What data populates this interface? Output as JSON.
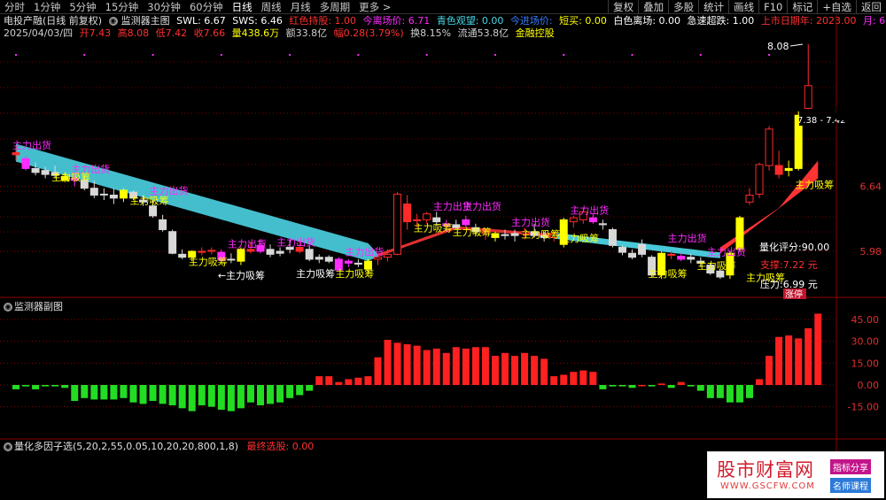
{
  "toolbar": {
    "periods": [
      "分时",
      "1分钟",
      "5分钟",
      "15分钟",
      "30分钟",
      "60分钟",
      "日线",
      "周线",
      "月线",
      "多周期",
      "更多 >"
    ],
    "active_period": "日线",
    "buttons": [
      "复权",
      "叠加",
      "多股",
      "统计",
      "画线",
      "F10",
      "标记",
      "+自选",
      "返回"
    ]
  },
  "header": {
    "stock": "电投产融(日线 前复权)",
    "indicator": "监测器主图",
    "swl": "SWL: 6.67",
    "sws": "SWS: 6.46",
    "hongse": "红色持股: 1.00",
    "jinri": "今离场价: 6.71",
    "qingse": "青色观望: 0.00",
    "jinjin": "今进场价: ",
    "duanmai": "短买: 0.00",
    "baise": "白色离场: 0.00",
    "jisu": "急速超跌: 1.00",
    "shangshi": "上市日期年: 2023.00",
    "yue": "月: 6.00"
  },
  "quote": {
    "date": "2025/04/03/四",
    "open": "开7.43",
    "high": "高8.08",
    "low": "低7.42",
    "close": "收7.66",
    "volume": "量438.6万",
    "amount": "额33.8亿",
    "change": "幅0.28(3.79%)",
    "turnover": "换8.15%",
    "float": "流通53.8亿",
    "concept": "金融控股"
  },
  "main_chart": {
    "price_ticks": [
      "7.38",
      "6.64",
      "5.98"
    ],
    "high_label": "8.08",
    "current_range": "7.38 - 7.42",
    "annotations": {
      "chu": "主力出货",
      "xi": "主力吸筹",
      "xi2": "主力吸筹",
      "xi_arrow": "←主力吸筹"
    },
    "score": "量化评分:90.00",
    "support": "支撑:7.22 元",
    "pressure": "压力:6.99 元",
    "zhangting": "涨停"
  },
  "sub_chart": {
    "title": "监测器副图",
    "ticks": [
      "45.00",
      "30.00",
      "15.00",
      "0.00",
      "-15.00"
    ]
  },
  "factor_panel": {
    "title": "量化多因子选(5,20,2,55,0.05,10,20,20,800,1,8)",
    "result": "最终选股: 0.00"
  },
  "watermark": {
    "name": "股市财富网",
    "url": "WWW.GSCFW.COM",
    "tag1": "指标分享",
    "tag2": "名师课程"
  },
  "colors": {
    "up": "#ff2a2a",
    "down": "#00d000",
    "magenta": "#ff2bff",
    "yellow": "#ffff00",
    "cyan": "#48c8d8",
    "grid": "#8b0000"
  },
  "chart_data": {
    "type": "candlestick",
    "candles": [
      {
        "o": 6.98,
        "h": 7.05,
        "l": 6.9,
        "c": 6.96,
        "cl": "red"
      },
      {
        "o": 6.92,
        "h": 6.95,
        "l": 6.8,
        "c": 6.82,
        "cl": "magenta"
      },
      {
        "o": 6.82,
        "h": 6.88,
        "l": 6.75,
        "c": 6.78,
        "cl": "white"
      },
      {
        "o": 6.8,
        "h": 6.84,
        "l": 6.72,
        "c": 6.76,
        "cl": "white"
      },
      {
        "o": 6.78,
        "h": 6.85,
        "l": 6.72,
        "c": 6.75,
        "cl": "white"
      },
      {
        "o": 6.74,
        "h": 6.78,
        "l": 6.68,
        "c": 6.7,
        "cl": "yellow"
      },
      {
        "o": 6.7,
        "h": 6.76,
        "l": 6.64,
        "c": 6.72,
        "cl": "magenta"
      },
      {
        "o": 6.7,
        "h": 6.74,
        "l": 6.6,
        "c": 6.62,
        "cl": "white"
      },
      {
        "o": 6.62,
        "h": 6.7,
        "l": 6.52,
        "c": 6.55,
        "cl": "white"
      },
      {
        "o": 6.56,
        "h": 6.62,
        "l": 6.5,
        "c": 6.56,
        "cl": "white"
      },
      {
        "o": 6.55,
        "h": 6.62,
        "l": 6.46,
        "c": 6.52,
        "cl": "white"
      },
      {
        "o": 6.52,
        "h": 6.62,
        "l": 6.48,
        "c": 6.6,
        "cl": "yellow"
      },
      {
        "o": 6.58,
        "h": 6.6,
        "l": 6.5,
        "c": 6.52,
        "cl": "white"
      },
      {
        "o": 6.5,
        "h": 6.55,
        "l": 6.44,
        "c": 6.48,
        "cl": "white"
      },
      {
        "o": 6.44,
        "h": 6.5,
        "l": 6.32,
        "c": 6.34,
        "cl": "white"
      },
      {
        "o": 6.3,
        "h": 6.35,
        "l": 6.18,
        "c": 6.2,
        "cl": "white"
      },
      {
        "o": 6.18,
        "h": 6.2,
        "l": 5.95,
        "c": 5.96,
        "cl": "white"
      },
      {
        "o": 5.95,
        "h": 6.0,
        "l": 5.9,
        "c": 5.92,
        "cl": "white"
      },
      {
        "o": 5.92,
        "h": 5.99,
        "l": 5.88,
        "c": 5.98,
        "cl": "yellow"
      },
      {
        "o": 5.98,
        "h": 6.02,
        "l": 5.94,
        "c": 5.97,
        "cl": "red"
      },
      {
        "o": 5.98,
        "h": 6.02,
        "l": 5.95,
        "c": 5.99,
        "cl": "red"
      },
      {
        "o": 5.97,
        "h": 6.0,
        "l": 5.88,
        "c": 5.89,
        "cl": "magenta"
      },
      {
        "o": 5.9,
        "h": 5.96,
        "l": 5.86,
        "c": 5.9,
        "cl": "white"
      },
      {
        "o": 5.88,
        "h": 6.02,
        "l": 5.84,
        "c": 6.0,
        "cl": "yellow"
      },
      {
        "o": 6.0,
        "h": 6.08,
        "l": 5.96,
        "c": 5.98,
        "cl": "red"
      },
      {
        "o": 5.98,
        "h": 6.1,
        "l": 5.96,
        "c": 6.04,
        "cl": "magenta"
      },
      {
        "o": 6.0,
        "h": 6.05,
        "l": 5.92,
        "c": 5.95,
        "cl": "white"
      },
      {
        "o": 5.96,
        "h": 6.02,
        "l": 5.93,
        "c": 5.98,
        "cl": "white"
      },
      {
        "o": 6.02,
        "h": 6.1,
        "l": 5.96,
        "c": 6.0,
        "cl": "white"
      },
      {
        "o": 6.02,
        "h": 6.08,
        "l": 5.96,
        "c": 5.98,
        "cl": "red"
      },
      {
        "o": 6.0,
        "h": 6.04,
        "l": 5.88,
        "c": 5.9,
        "cl": "white"
      },
      {
        "o": 5.9,
        "h": 5.95,
        "l": 5.86,
        "c": 5.92,
        "cl": "white"
      },
      {
        "o": 5.92,
        "h": 5.94,
        "l": 5.86,
        "c": 5.88,
        "cl": "white"
      },
      {
        "o": 5.9,
        "h": 5.92,
        "l": 5.78,
        "c": 5.79,
        "cl": "magenta"
      },
      {
        "o": 5.88,
        "h": 5.9,
        "l": 5.82,
        "c": 5.86,
        "cl": "magenta"
      },
      {
        "o": 5.86,
        "h": 5.9,
        "l": 5.82,
        "c": 5.85,
        "cl": "white"
      },
      {
        "o": 5.8,
        "h": 5.9,
        "l": 5.76,
        "c": 5.88,
        "cl": "yellow"
      },
      {
        "o": 5.9,
        "h": 5.96,
        "l": 5.84,
        "c": 5.92,
        "cl": "red"
      },
      {
        "o": 5.92,
        "h": 6.0,
        "l": 5.88,
        "c": 5.95,
        "cl": "red"
      },
      {
        "o": 5.95,
        "h": 6.58,
        "l": 5.94,
        "c": 6.56,
        "cl": "red"
      },
      {
        "o": 6.46,
        "h": 6.55,
        "l": 6.2,
        "c": 6.28,
        "cl": "red"
      },
      {
        "o": 6.3,
        "h": 6.36,
        "l": 6.22,
        "c": 6.3,
        "cl": "red"
      },
      {
        "o": 6.3,
        "h": 6.38,
        "l": 6.26,
        "c": 6.36,
        "cl": "red"
      },
      {
        "o": 6.32,
        "h": 6.38,
        "l": 6.24,
        "c": 6.28,
        "cl": "white"
      },
      {
        "o": 6.26,
        "h": 6.3,
        "l": 6.18,
        "c": 6.24,
        "cl": "magenta"
      },
      {
        "o": 6.25,
        "h": 6.3,
        "l": 6.2,
        "c": 6.22,
        "cl": "white"
      },
      {
        "o": 6.25,
        "h": 6.34,
        "l": 6.22,
        "c": 6.3,
        "cl": "magenta"
      },
      {
        "o": 6.22,
        "h": 6.26,
        "l": 6.14,
        "c": 6.18,
        "cl": "white"
      },
      {
        "o": 6.16,
        "h": 6.22,
        "l": 6.1,
        "c": 6.18,
        "cl": "red"
      },
      {
        "o": 6.12,
        "h": 6.18,
        "l": 6.08,
        "c": 6.16,
        "cl": "yellow"
      },
      {
        "o": 6.15,
        "h": 6.2,
        "l": 6.1,
        "c": 6.14,
        "cl": "white"
      },
      {
        "o": 6.14,
        "h": 6.2,
        "l": 6.08,
        "c": 6.16,
        "cl": "white"
      },
      {
        "o": 6.16,
        "h": 6.22,
        "l": 6.1,
        "c": 6.18,
        "cl": "red"
      },
      {
        "o": 6.18,
        "h": 6.26,
        "l": 6.12,
        "c": 6.14,
        "cl": "white"
      },
      {
        "o": 6.14,
        "h": 6.18,
        "l": 6.08,
        "c": 6.12,
        "cl": "white"
      },
      {
        "o": 6.12,
        "h": 6.18,
        "l": 6.08,
        "c": 6.16,
        "cl": "red"
      },
      {
        "o": 6.05,
        "h": 6.32,
        "l": 6.02,
        "c": 6.3,
        "cl": "yellow"
      },
      {
        "o": 6.28,
        "h": 6.34,
        "l": 6.22,
        "c": 6.32,
        "cl": "red"
      },
      {
        "o": 6.3,
        "h": 6.42,
        "l": 6.26,
        "c": 6.38,
        "cl": "red"
      },
      {
        "o": 6.32,
        "h": 6.36,
        "l": 6.26,
        "c": 6.28,
        "cl": "magenta"
      },
      {
        "o": 6.25,
        "h": 6.3,
        "l": 6.2,
        "c": 6.26,
        "cl": "white"
      },
      {
        "o": 6.2,
        "h": 6.22,
        "l": 6.02,
        "c": 6.04,
        "cl": "white"
      },
      {
        "o": 6.02,
        "h": 6.04,
        "l": 5.94,
        "c": 5.97,
        "cl": "white"
      },
      {
        "o": 5.96,
        "h": 6.0,
        "l": 5.9,
        "c": 5.92,
        "cl": "white"
      },
      {
        "o": 6.05,
        "h": 6.1,
        "l": 5.92,
        "c": 5.95,
        "cl": "white"
      },
      {
        "o": 5.92,
        "h": 5.94,
        "l": 5.72,
        "c": 5.74,
        "cl": "white"
      },
      {
        "o": 5.74,
        "h": 5.98,
        "l": 5.7,
        "c": 5.96,
        "cl": "yellow"
      },
      {
        "o": 5.95,
        "h": 5.98,
        "l": 5.9,
        "c": 5.94,
        "cl": "red"
      },
      {
        "o": 5.93,
        "h": 5.96,
        "l": 5.88,
        "c": 5.9,
        "cl": "magenta"
      },
      {
        "o": 5.92,
        "h": 5.96,
        "l": 5.86,
        "c": 5.9,
        "cl": "white"
      },
      {
        "o": 5.88,
        "h": 5.92,
        "l": 5.82,
        "c": 5.86,
        "cl": "white"
      },
      {
        "o": 5.84,
        "h": 5.86,
        "l": 5.74,
        "c": 5.76,
        "cl": "white"
      },
      {
        "o": 5.78,
        "h": 5.8,
        "l": 5.7,
        "c": 5.72,
        "cl": "white"
      },
      {
        "o": 5.74,
        "h": 5.98,
        "l": 5.7,
        "c": 5.96,
        "cl": "yellow"
      },
      {
        "o": 6.0,
        "h": 6.34,
        "l": 5.98,
        "c": 6.32,
        "cl": "yellow"
      },
      {
        "o": 6.48,
        "h": 6.62,
        "l": 6.45,
        "c": 6.55,
        "cl": "red"
      },
      {
        "o": 6.56,
        "h": 6.88,
        "l": 6.52,
        "c": 6.86,
        "cl": "red"
      },
      {
        "o": 6.85,
        "h": 7.25,
        "l": 6.8,
        "c": 7.22,
        "cl": "red"
      },
      {
        "o": 6.85,
        "h": 7.0,
        "l": 6.72,
        "c": 6.76,
        "cl": "red"
      },
      {
        "o": 6.8,
        "h": 6.9,
        "l": 6.74,
        "c": 6.82,
        "cl": "yellow"
      },
      {
        "o": 6.82,
        "h": 7.4,
        "l": 6.8,
        "c": 7.36,
        "cl": "yellow"
      },
      {
        "o": 7.43,
        "h": 8.08,
        "l": 7.42,
        "c": 7.66,
        "cl": "red"
      }
    ],
    "sub_values": [
      -3,
      -1,
      -3,
      -1,
      -1,
      -2,
      -11,
      -9,
      -10,
      -10,
      -10,
      -9,
      -12,
      -13,
      -11,
      -13,
      -14,
      -16,
      -18,
      -14,
      -15,
      -17,
      -18,
      -16,
      -12,
      -14,
      -13,
      -12,
      -9,
      -7,
      -4,
      6,
      6,
      2,
      4,
      5,
      6,
      19,
      31,
      29,
      28,
      27,
      24,
      25,
      22,
      26,
      25,
      26,
      26,
      20,
      22,
      20,
      22,
      20,
      18,
      6,
      7,
      9,
      10,
      9,
      -3,
      -1,
      -1,
      -2,
      0,
      -1,
      1,
      -2,
      2,
      -1,
      -4,
      -9,
      -9,
      -12,
      -12,
      -9,
      4,
      20,
      33,
      34,
      32,
      39,
      49
    ]
  }
}
